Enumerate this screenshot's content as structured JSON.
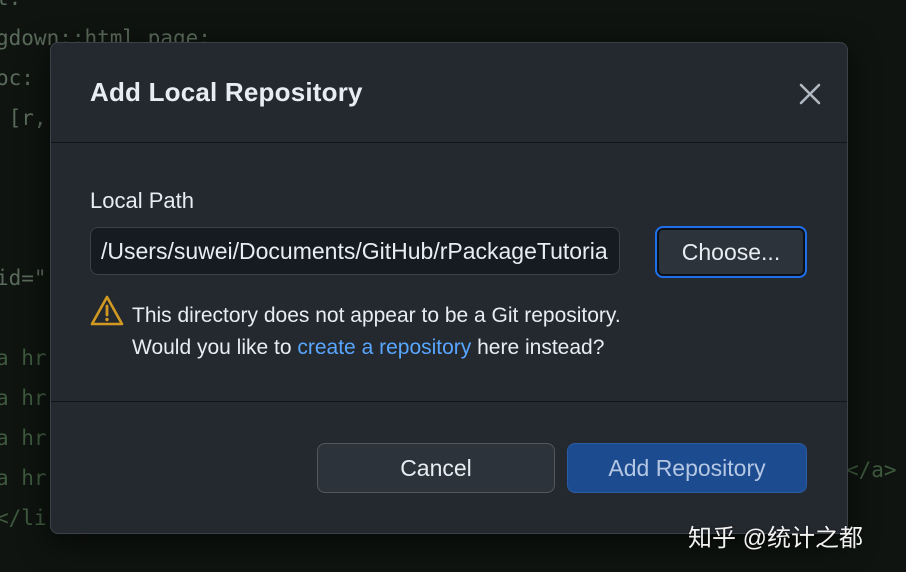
{
  "background_code": {
    "lines": [
      "t:",
      "gdown::html_page:",
      "oc:",
      " [r,",
      "",
      "",
      "id=\"",
      "",
      "a hr",
      "a hr",
      "a hr",
      "a hr",
      "</li"
    ],
    "tail_fragment": "</a>"
  },
  "dialog": {
    "title": "Add Local Repository",
    "close_icon": "close-icon",
    "local_path_label": "Local Path",
    "local_path_value": "/Users/suwei/Documents/GitHub/rPackageTutorial",
    "choose_label": "Choose...",
    "warning": {
      "icon": "warning-triangle-icon",
      "line1": "This directory does not appear to be a Git repository.",
      "line2_before": "Would you like to ",
      "link_text": "create a repository",
      "line2_after": " here instead?"
    },
    "cancel_label": "Cancel",
    "add_label": "Add Repository"
  },
  "watermark": "知乎 @统计之都",
  "colors": {
    "dialog_bg": "#24292f",
    "accent_blue": "#1f6feb",
    "link_blue": "#58a6ff",
    "warning_yellow": "#d29922",
    "primary_button_bg": "#1d4b8f"
  }
}
